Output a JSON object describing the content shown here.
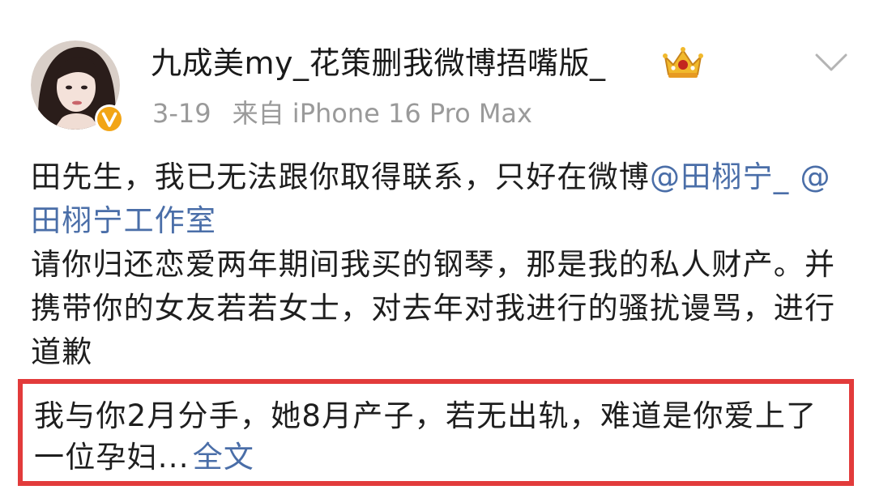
{
  "post": {
    "author": {
      "name": "九成美my_花策删我微博捂嘴版_",
      "avatar_icon": "user-avatar",
      "verified_badge_icon": "orange-v-badge",
      "member_crown_icon": "crown-icon"
    },
    "meta": {
      "date": "3-19",
      "source": "来自 iPhone 16 Pro Max"
    },
    "body": {
      "line1_prefix": "田先生，我已无法跟你取得联系，只好在微博",
      "mention1": "@田栩宁_",
      "line1_space": " ",
      "mention2": "@田栩宁工作室",
      "paragraph2": "请你归还恋爱两年期间我买的钢琴，那是我的私人财产。并携带你的女友若若女士，对去年对我进行的骚扰谩骂，进行道歉",
      "cut_line": "扰谩骂，进行道歉"
    },
    "highlight": {
      "text": "我与你2月分手，她8月产子，若无出轨，难道是你爱上了一位孕妇...",
      "full_text_link": "全文",
      "border_color": "#e23b3b"
    },
    "colors": {
      "link": "#4a6ea8",
      "meta": "#9a9a9a"
    }
  }
}
